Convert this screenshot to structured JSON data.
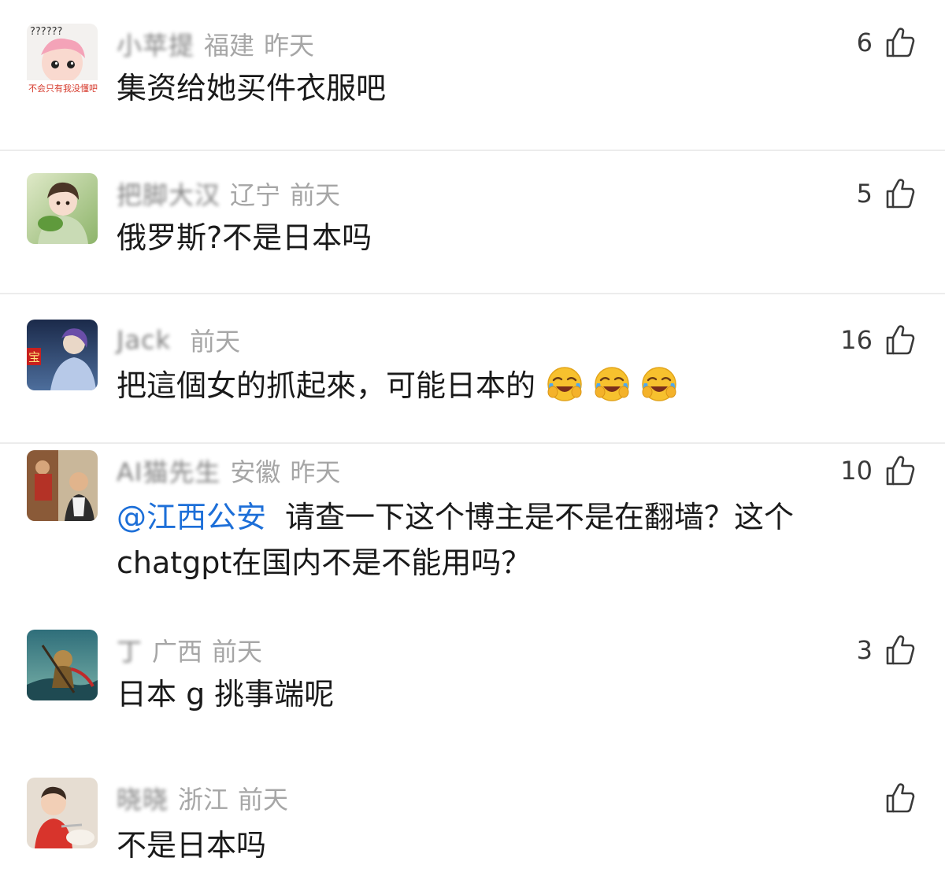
{
  "comments": [
    {
      "name": "小苹提",
      "location": "福建",
      "time": "昨天",
      "likes": "6",
      "text": "集资给她买件衣服吧",
      "avatar_caption": "不会只有我没懂吧",
      "avatar_top_text": "??????"
    },
    {
      "name": "把脚大汉",
      "location": "辽宁",
      "time": "前天",
      "likes": "5",
      "text": "俄罗斯?不是日本吗"
    },
    {
      "name": "Jack",
      "location": "",
      "time": "前天",
      "likes": "16",
      "text": "把這個女的抓起來，可能日本的",
      "emoji": [
        "crying-laughing-emoji",
        "crying-laughing-emoji",
        "crying-laughing-emoji"
      ],
      "avatar_badge": "宝"
    },
    {
      "name": "AI猫先生",
      "location": "安徽",
      "time": "昨天",
      "likes": "10",
      "mention": "@江西公安",
      "text": "请查一下这个博主是不是在翻墙？这个chatgpt在国内不是不能用吗？"
    },
    {
      "name": "丁",
      "location": "广西",
      "time": "前天",
      "likes": "3",
      "text": "日本 g 挑事端呢"
    },
    {
      "name": "晓晓",
      "location": "浙江",
      "time": "前天",
      "likes": "",
      "text": "不是日本吗"
    }
  ],
  "colors": {
    "meta_gray": "#a6a6a6",
    "mention_blue": "#1d6fd8",
    "divider": "#ececec",
    "text": "#1a1a1a"
  }
}
